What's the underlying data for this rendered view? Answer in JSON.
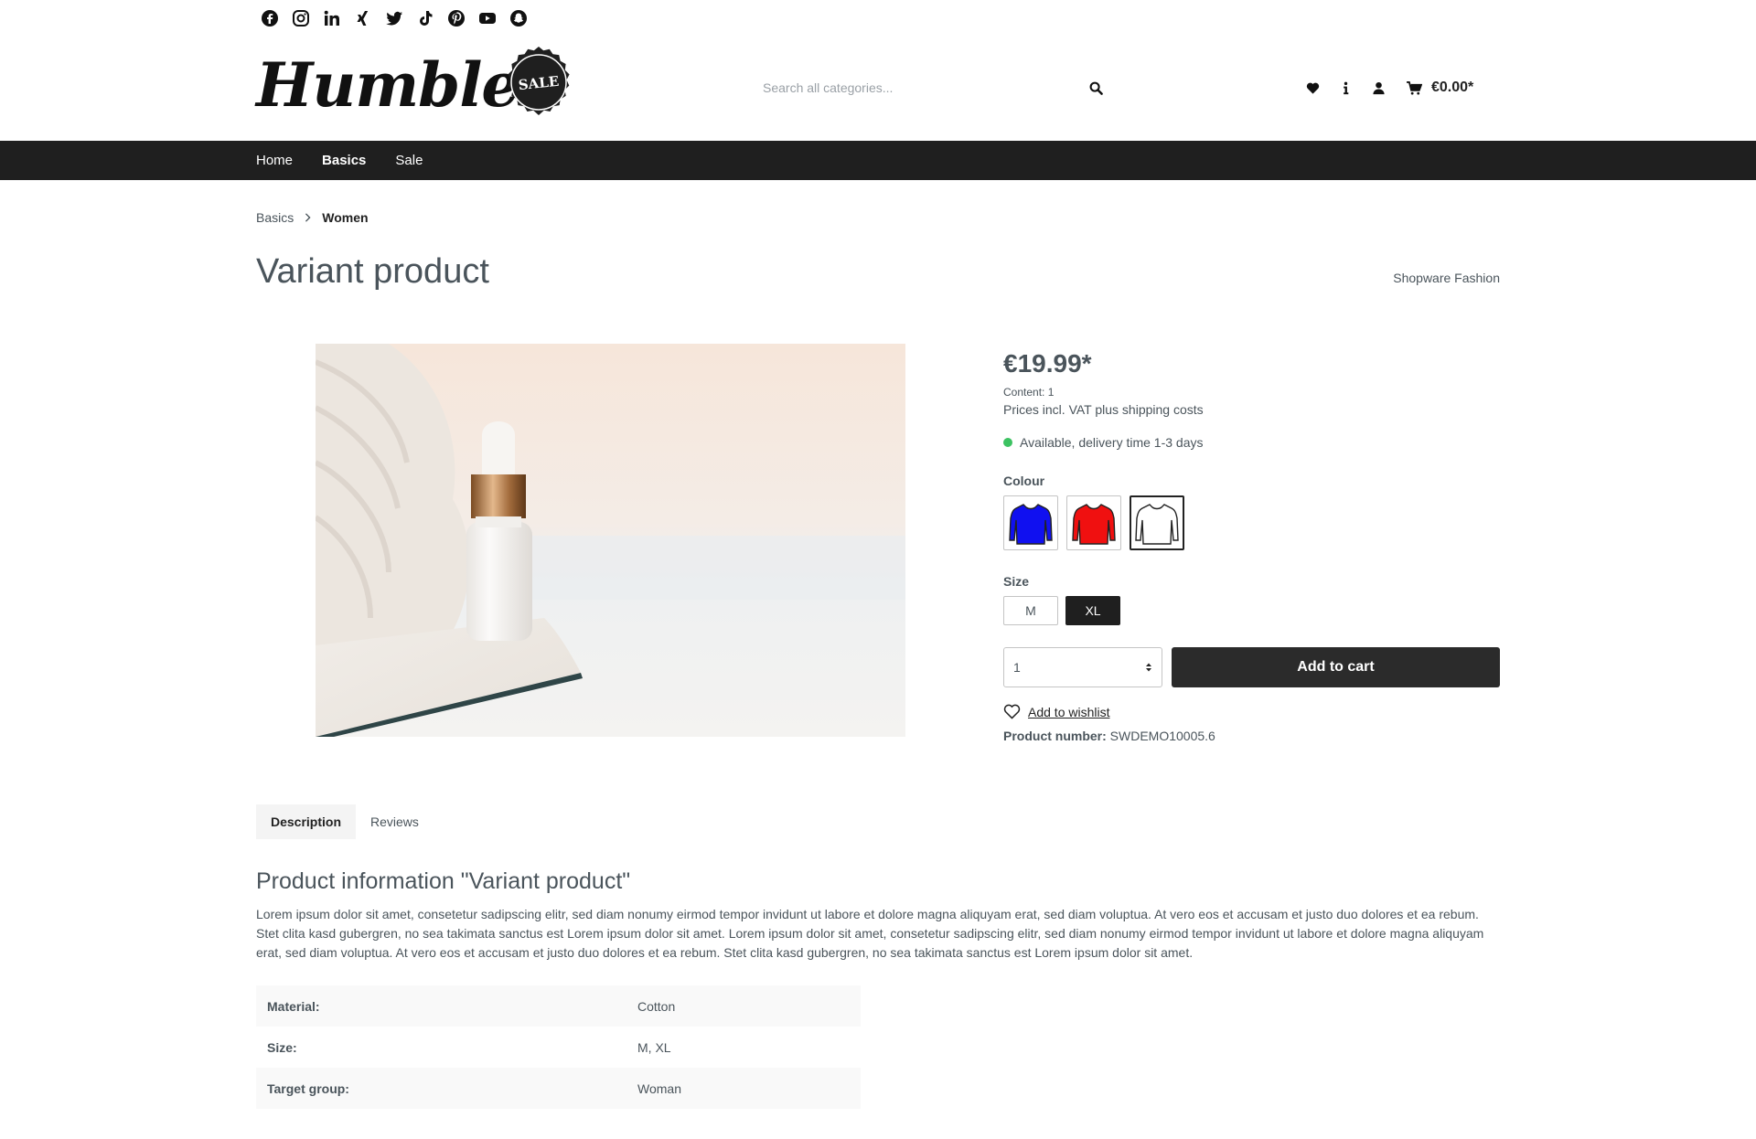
{
  "social": [
    {
      "name": "facebook-icon"
    },
    {
      "name": "instagram-icon"
    },
    {
      "name": "linkedin-icon"
    },
    {
      "name": "xing-icon"
    },
    {
      "name": "twitter-icon"
    },
    {
      "name": "tiktok-icon"
    },
    {
      "name": "pinterest-icon"
    },
    {
      "name": "youtube-icon"
    },
    {
      "name": "snapchat-icon"
    }
  ],
  "header": {
    "logo_text": "Humble",
    "badge_text": "SALE",
    "search_placeholder": "Search all categories...",
    "cart_total": "€0.00*"
  },
  "nav": {
    "items": [
      {
        "label": "Home"
      },
      {
        "label": "Basics"
      },
      {
        "label": "Sale"
      }
    ]
  },
  "breadcrumb": {
    "items": [
      {
        "label": "Basics"
      },
      {
        "label": "Women"
      }
    ]
  },
  "product": {
    "title": "Variant product",
    "manufacturer": "Shopware Fashion",
    "price": "€19.99*",
    "content_info": "Content: 1",
    "tax_info": "Prices incl. VAT plus shipping costs",
    "delivery": "Available, delivery time 1-3 days",
    "colour_label": "Colour",
    "colours": [
      {
        "name": "blue",
        "hex": "#1010f0"
      },
      {
        "name": "red",
        "hex": "#f01010"
      },
      {
        "name": "white",
        "hex": "#ffffff"
      }
    ],
    "size_label": "Size",
    "sizes": [
      {
        "label": "M"
      },
      {
        "label": "XL"
      }
    ],
    "quantity": "1",
    "add_to_cart": "Add to cart",
    "wishlist": "Add to wishlist",
    "product_number_label": "Product number:",
    "product_number": "SWDEMO10005.6"
  },
  "tabs": [
    {
      "label": "Description"
    },
    {
      "label": "Reviews"
    }
  ],
  "description": {
    "title": "Product information \"Variant product\"",
    "text": "Lorem ipsum dolor sit amet, consetetur sadipscing elitr, sed diam nonumy eirmod tempor invidunt ut labore et dolore magna aliquyam erat, sed diam voluptua. At vero eos et accusam et justo duo dolores et ea rebum. Stet clita kasd gubergren, no sea takimata sanctus est Lorem ipsum dolor sit amet. Lorem ipsum dolor sit amet, consetetur sadipscing elitr, sed diam nonumy eirmod tempor invidunt ut labore et dolore magna aliquyam erat, sed diam voluptua. At vero eos et accusam et justo duo dolores et ea rebum. Stet clita kasd gubergren, no sea takimata sanctus est Lorem ipsum dolor sit amet."
  },
  "properties": [
    {
      "key": "Material:",
      "value": "Cotton"
    },
    {
      "key": "Size:",
      "value": "M, XL"
    },
    {
      "key": "Target group:",
      "value": "Woman"
    }
  ],
  "colors": {
    "nav_bg": "#1f1f1f",
    "text": "#4a545b",
    "available": "#3cc261",
    "button": "#2b2b2b"
  }
}
